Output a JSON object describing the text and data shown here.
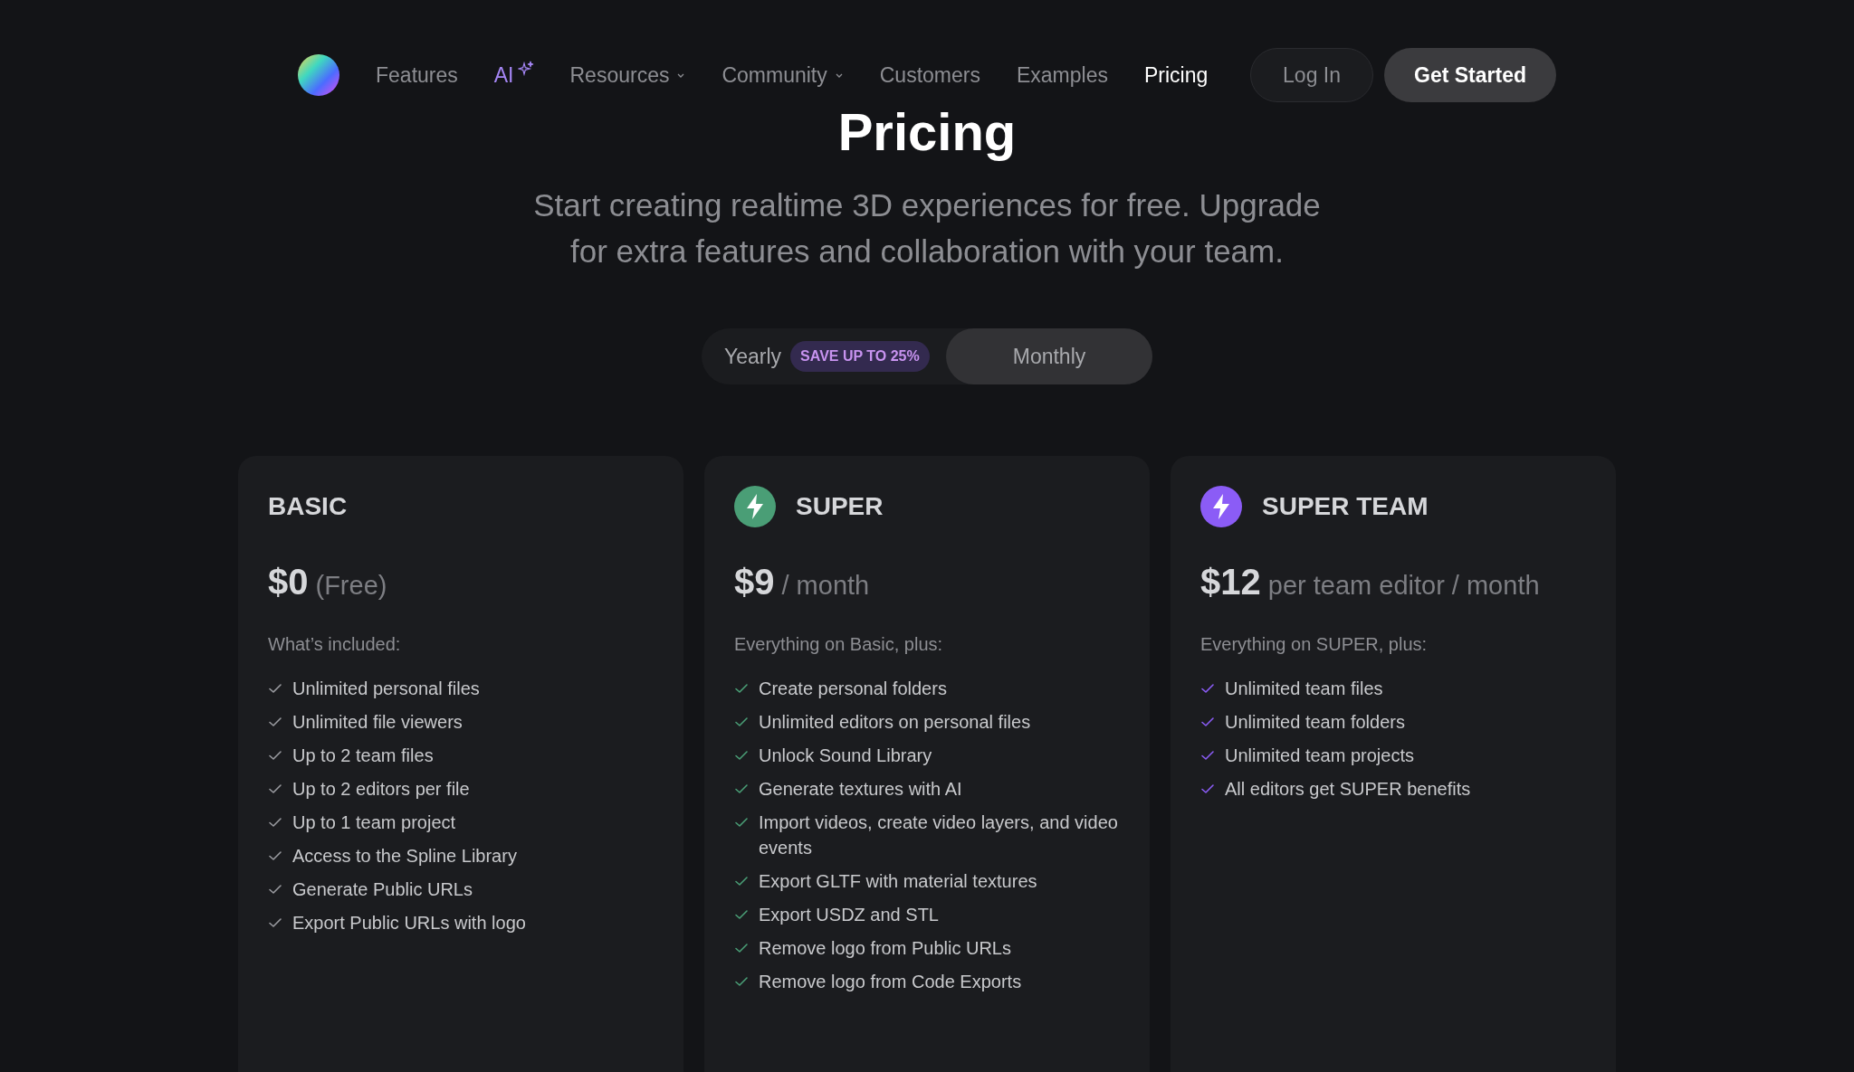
{
  "nav": {
    "items": [
      {
        "label": "Features",
        "kind": "link",
        "selected": false
      },
      {
        "label": "AI",
        "kind": "ai",
        "selected": false
      },
      {
        "label": "Resources",
        "kind": "dropdown",
        "selected": false
      },
      {
        "label": "Community",
        "kind": "dropdown",
        "selected": false
      },
      {
        "label": "Customers",
        "kind": "link",
        "selected": false
      },
      {
        "label": "Examples",
        "kind": "link",
        "selected": false
      },
      {
        "label": "Pricing",
        "kind": "link",
        "selected": true
      }
    ],
    "login": "Log In",
    "cta": "Get Started"
  },
  "title": "Pricing",
  "subtitle": "Start creating realtime 3D experiences for free. Upgrade for extra features and collaboration with your team.",
  "billing": [
    {
      "label": "Yearly",
      "badge": "SAVE UP TO 25%",
      "selected": false
    },
    {
      "label": "Monthly",
      "selected": true
    }
  ],
  "plans": [
    {
      "name": "BASIC",
      "kind": "plain",
      "color": "#9a9ba0",
      "price": "$0",
      "period": "(Free)",
      "intro": "What’s included:",
      "features": [
        "Unlimited personal files",
        "Unlimited file viewers",
        "Up to 2 team files",
        "Up to 2 editors per file",
        "Up to 1 team project",
        "Access to the Spline Library",
        "Generate Public URLs",
        "Export Public URLs with logo"
      ]
    },
    {
      "name": "SUPER",
      "kind": "bolt",
      "color": "#4a9e76",
      "price": "$9",
      "period": "/ month",
      "intro": "Everything on Basic, plus:",
      "features": [
        "Create personal folders",
        "Unlimited editors on personal files",
        "Unlock Sound Library",
        "Generate textures with AI",
        "Import videos, create video layers, and video events",
        "Export GLTF with material textures",
        "Export USDZ and STL",
        "Remove logo from Public URLs",
        "Remove logo from Code Exports"
      ]
    },
    {
      "name": "SUPER TEAM",
      "kind": "bolt",
      "color": "#8b5cf6",
      "price": "$12",
      "period": "per team editor / month",
      "intro": "Everything on SUPER, plus:",
      "features": [
        "Unlimited team files",
        "Unlimited team folders",
        "Unlimited team projects",
        "All editors get SUPER benefits"
      ]
    }
  ]
}
